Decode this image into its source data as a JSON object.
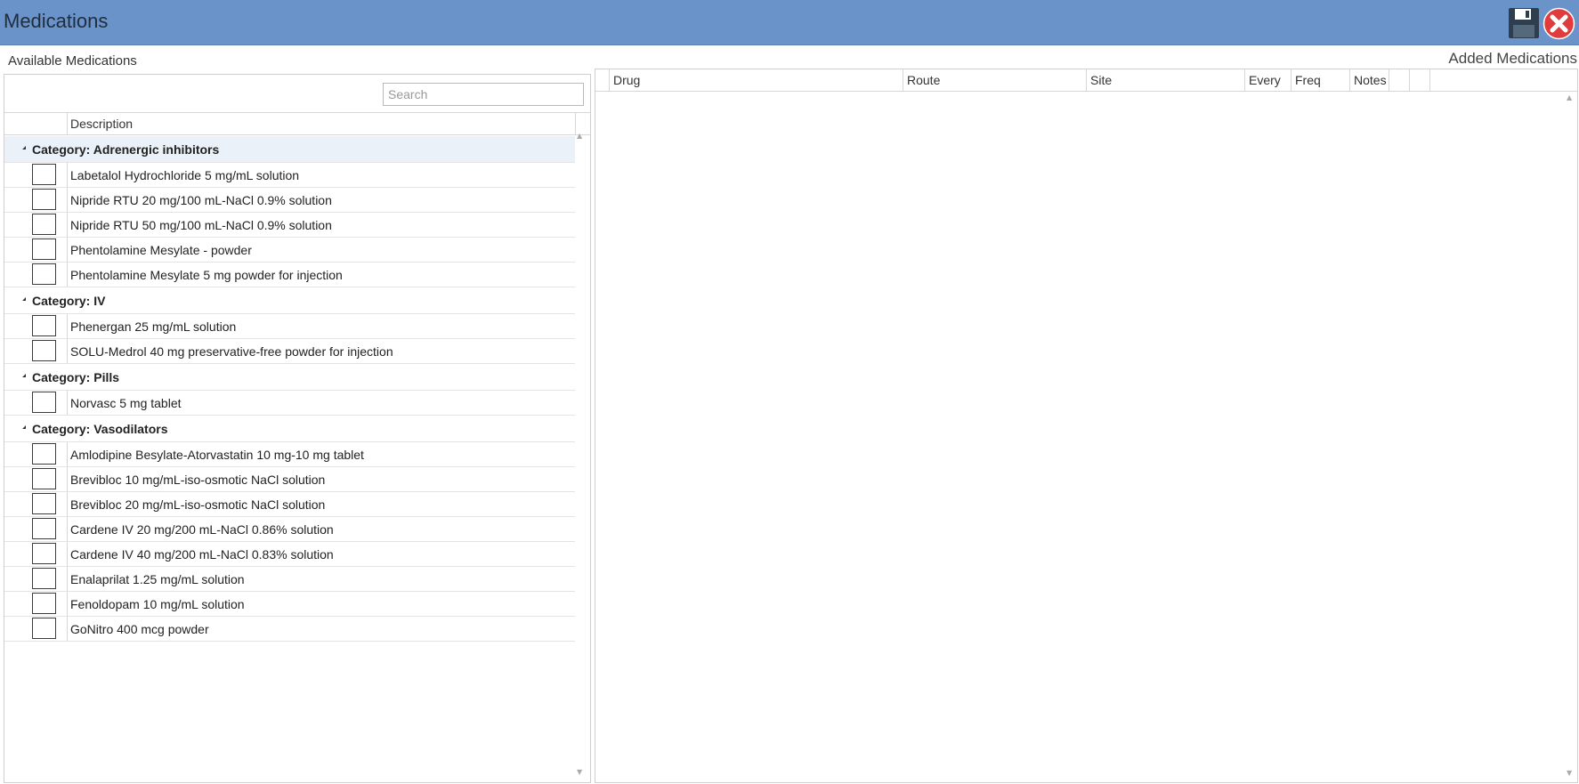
{
  "window": {
    "title": "Medications"
  },
  "toolbar": {
    "save_icon": "save-icon",
    "close_icon": "close-icon",
    "close_color": "#e23b3b"
  },
  "available": {
    "label": "Available Medications",
    "search": {
      "placeholder": "Search",
      "value": ""
    },
    "columns": {
      "description": "Description"
    },
    "groups": [
      {
        "category": "Category: Adrenergic inhibitors",
        "items": [
          "Labetalol Hydrochloride 5 mg/mL solution",
          "Nipride RTU 20 mg/100 mL-NaCl 0.9% solution",
          "Nipride RTU 50 mg/100 mL-NaCl 0.9% solution",
          "Phentolamine Mesylate - powder",
          "Phentolamine Mesylate 5 mg powder for injection"
        ]
      },
      {
        "category": "Category: IV",
        "items": [
          "Phenergan 25 mg/mL solution",
          "SOLU-Medrol 40 mg preservative-free powder for injection"
        ]
      },
      {
        "category": "Category: Pills",
        "items": [
          "Norvasc 5 mg tablet"
        ]
      },
      {
        "category": "Category: Vasodilators",
        "items": [
          "Amlodipine Besylate-Atorvastatin 10 mg-10 mg tablet",
          "Brevibloc 10 mg/mL-iso-osmotic NaCl solution",
          "Brevibloc 20 mg/mL-iso-osmotic NaCl solution",
          "Cardene IV 20 mg/200 mL-NaCl 0.86% solution",
          "Cardene IV 40 mg/200 mL-NaCl 0.83% solution",
          "Enalaprilat 1.25 mg/mL solution",
          "Fenoldopam 10 mg/mL solution",
          "GoNitro 400 mcg powder"
        ]
      }
    ]
  },
  "added": {
    "label": "Added Medications",
    "columns": [
      "",
      "Drug",
      "Route",
      "Site",
      "Every",
      "Freq",
      "Notes",
      "",
      "",
      ""
    ]
  }
}
